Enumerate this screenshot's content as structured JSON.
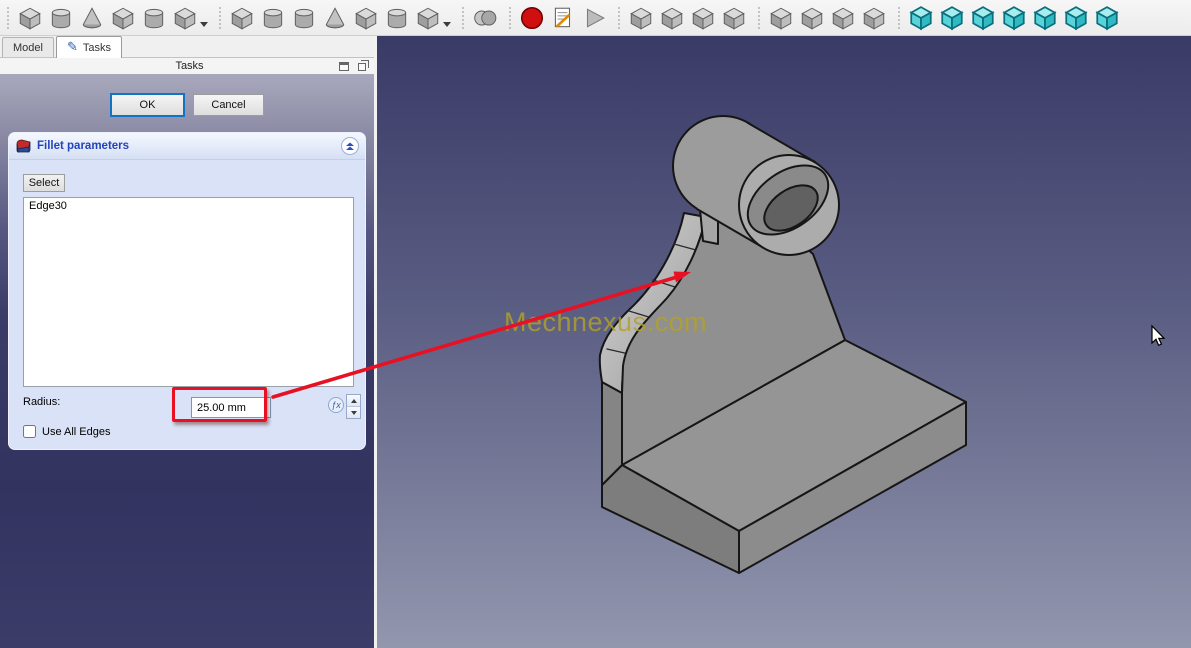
{
  "toolbar": {
    "groups": [
      {
        "name": "additive-tools",
        "items": [
          {
            "name": "pad",
            "icon": "cube"
          },
          {
            "name": "revolution",
            "icon": "cyl"
          },
          {
            "name": "additive-loft",
            "icon": "cone"
          },
          {
            "name": "additive-pipe",
            "icon": "cube"
          },
          {
            "name": "additive-helix",
            "icon": "cyl"
          },
          {
            "name": "additive-primitive",
            "icon": "cube",
            "dropdown": true
          }
        ]
      },
      {
        "name": "subtractive-tools",
        "items": [
          {
            "name": "pocket",
            "icon": "cube"
          },
          {
            "name": "hole",
            "icon": "cyl"
          },
          {
            "name": "groove",
            "icon": "cyl"
          },
          {
            "name": "subtractive-loft",
            "icon": "cone"
          },
          {
            "name": "subtractive-pipe",
            "icon": "cube"
          },
          {
            "name": "subtractive-helix",
            "icon": "cyl"
          },
          {
            "name": "subtractive-primitive",
            "icon": "cube",
            "dropdown": true
          }
        ]
      },
      {
        "name": "boolean-tools",
        "items": [
          {
            "name": "boolean-operation",
            "icon": "sphere"
          }
        ]
      },
      {
        "name": "macro-tools",
        "items": [
          {
            "name": "record-macro",
            "icon": "record"
          },
          {
            "name": "edit-macro",
            "icon": "doc"
          },
          {
            "name": "execute-macro",
            "icon": "play"
          }
        ]
      },
      {
        "name": "dressup-tools",
        "items": [
          {
            "name": "fillet",
            "icon": "cube"
          },
          {
            "name": "chamfer",
            "icon": "cube"
          },
          {
            "name": "draft",
            "icon": "cube"
          },
          {
            "name": "thickness",
            "icon": "cube"
          }
        ]
      },
      {
        "name": "transform-tools",
        "items": [
          {
            "name": "mirrored",
            "icon": "cube"
          },
          {
            "name": "linear-pattern",
            "icon": "cube"
          },
          {
            "name": "polar-pattern",
            "icon": "cube"
          },
          {
            "name": "multitransform",
            "icon": "cube"
          }
        ]
      },
      {
        "name": "view-tools",
        "items": [
          {
            "name": "view-isometric",
            "icon": "tealcube"
          },
          {
            "name": "view-front",
            "icon": "tealcube"
          },
          {
            "name": "view-top",
            "icon": "tealcube"
          },
          {
            "name": "view-right",
            "icon": "tealcube"
          },
          {
            "name": "view-rear",
            "icon": "tealcube"
          },
          {
            "name": "view-bottom",
            "icon": "tealcube"
          },
          {
            "name": "view-left",
            "icon": "tealcube"
          }
        ]
      }
    ]
  },
  "tabs": [
    {
      "label": "Model",
      "active": false
    },
    {
      "label": "Tasks",
      "active": true
    }
  ],
  "panel": {
    "title": "Tasks"
  },
  "actions": {
    "ok_label": "OK",
    "cancel_label": "Cancel"
  },
  "fillet_dialog": {
    "title": "Fillet parameters",
    "select_label": "Select",
    "edges": [
      "Edge30"
    ],
    "radius_label": "Radius:",
    "radius_value": "25.00 mm",
    "use_all_edges_label": "Use All Edges",
    "use_all_edges_checked": false
  },
  "viewport": {
    "watermark": "Mechnexus.com"
  },
  "colors": {
    "annotation_red": "#e81123",
    "watermark_yellow": "#b1a128",
    "dialog_header_blue": "#2244bb",
    "viewport_top": "#3a3a67",
    "viewport_bottom": "#9297ae",
    "view_icon_teal": "#2fb9c2",
    "record_red": "#d01010"
  }
}
